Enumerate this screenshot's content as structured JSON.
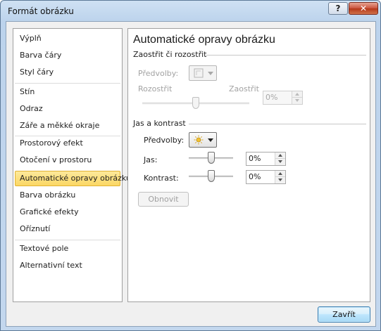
{
  "window": {
    "title": "Formát obrázku",
    "help_label": "?",
    "close_label": "✕"
  },
  "nav": {
    "items": [
      {
        "label": "Výplň"
      },
      {
        "label": "Barva čáry"
      },
      {
        "label": "Styl čáry"
      },
      {
        "label": "Stín"
      },
      {
        "label": "Odraz"
      },
      {
        "label": "Záře a měkké okraje"
      },
      {
        "label": "Prostorový efekt"
      },
      {
        "label": "Otočení v prostoru"
      },
      {
        "label": "Automatické opravy obrázku",
        "selected": true
      },
      {
        "label": "Barva obrázku"
      },
      {
        "label": "Grafické efekty"
      },
      {
        "label": "Oříznutí"
      },
      {
        "label": "Textové pole"
      },
      {
        "label": "Alternativní text"
      }
    ]
  },
  "panel": {
    "title": "Automatické opravy obrázku",
    "sharpen": {
      "heading": "Zaostřit či rozostřit",
      "presets_label": "Předvolby:",
      "blur_label": "Rozostřit",
      "sharpen_label": "Zaostřit",
      "value": "0%",
      "slider_level": 0.5,
      "enabled": false
    },
    "brightness_contrast": {
      "heading": "Jas a kontrast",
      "presets_label": "Předvolby:",
      "brightness_label": "Jas:",
      "brightness_value": "0%",
      "brightness_level": 0.5,
      "contrast_label": "Kontrast:",
      "contrast_value": "0%",
      "contrast_level": 0.5
    },
    "reset_label": "Obnovit"
  },
  "footer": {
    "close_label": "Zavřít"
  },
  "icons": {
    "sharpen_preset": "image-sharpen-icon",
    "brightness_preset": "sun-contrast-icon",
    "dropdown": "chevron-down-icon"
  },
  "colors": {
    "selected_bg": "#fbd764",
    "selected_border": "#e2b233",
    "disabled_text": "#a3a3a3",
    "primary_button": "#a7d9f5"
  }
}
